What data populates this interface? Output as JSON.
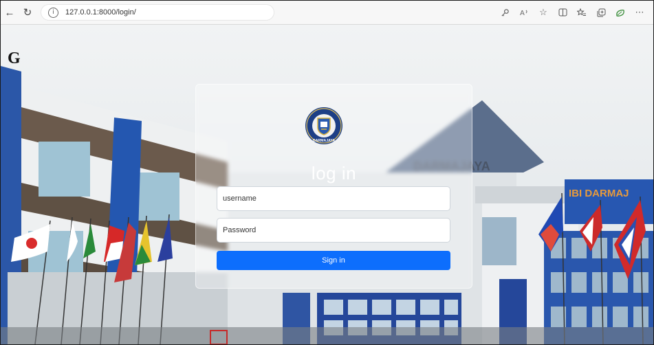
{
  "browser": {
    "url": "127.0.0.1:8000/login/",
    "info_glyph": "i",
    "icons": [
      "back-arrow-icon",
      "refresh-icon",
      "info-icon",
      "key-icon",
      "read-aloud-icon",
      "favorite-star-icon",
      "split-screen-icon",
      "favorites-icon",
      "collections-icon",
      "extensions-icon",
      "more-icon"
    ]
  },
  "page": {
    "corner_letter": "G",
    "building_sign": "DARMAJAYA",
    "side_sign": "IBI DARMAJ",
    "logo_text": "DARMAJAYA"
  },
  "login": {
    "title": "log in",
    "username_placeholder": "username",
    "password_placeholder": "Password",
    "submit_label": "Sign in"
  },
  "colors": {
    "primary_button": "#0d6efd",
    "sky": "#e8ecef",
    "building_blue": "#1f4fa0"
  }
}
